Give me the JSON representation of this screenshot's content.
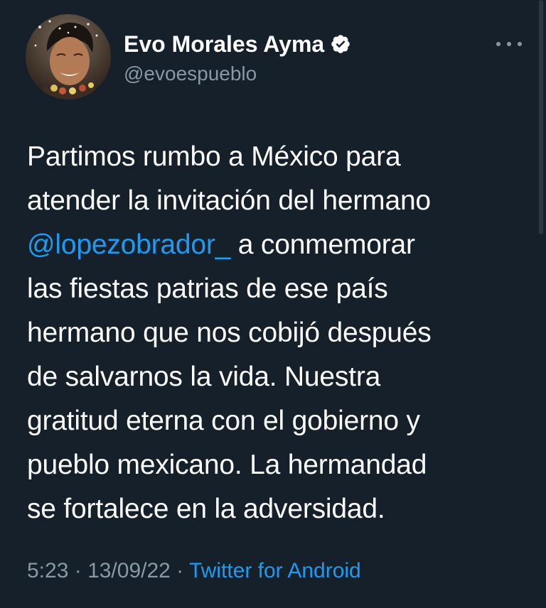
{
  "colors": {
    "background": "#15202b",
    "text_primary": "#ffffff",
    "text_secondary": "#8899a6",
    "accent": "#1d9bf0"
  },
  "author": {
    "display_name": "Evo Morales Ayma",
    "handle": "@evoespueblo",
    "verified_icon": "verified-badge-icon",
    "avatar_icon": "avatar-photo"
  },
  "more_icon": "more-options-icon",
  "tweet": {
    "lines": [
      "Partimos rumbo a México para",
      "atender la invitación del hermano"
    ],
    "mention": "@lopezobrador_",
    "mention_rest": " a conmemorar",
    "lines_after": [
      "las fiestas patrias de ese país",
      "hermano que nos cobijó después",
      "de salvarnos la vida. Nuestra",
      "gratitud eterna con el gobierno y",
      "pueblo mexicano. La hermandad",
      "se fortalece en la adversidad."
    ]
  },
  "meta": {
    "time": "5:23",
    "separator1": " · ",
    "date": "13/09/22",
    "separator2": " · ",
    "source": "Twitter for Android"
  }
}
